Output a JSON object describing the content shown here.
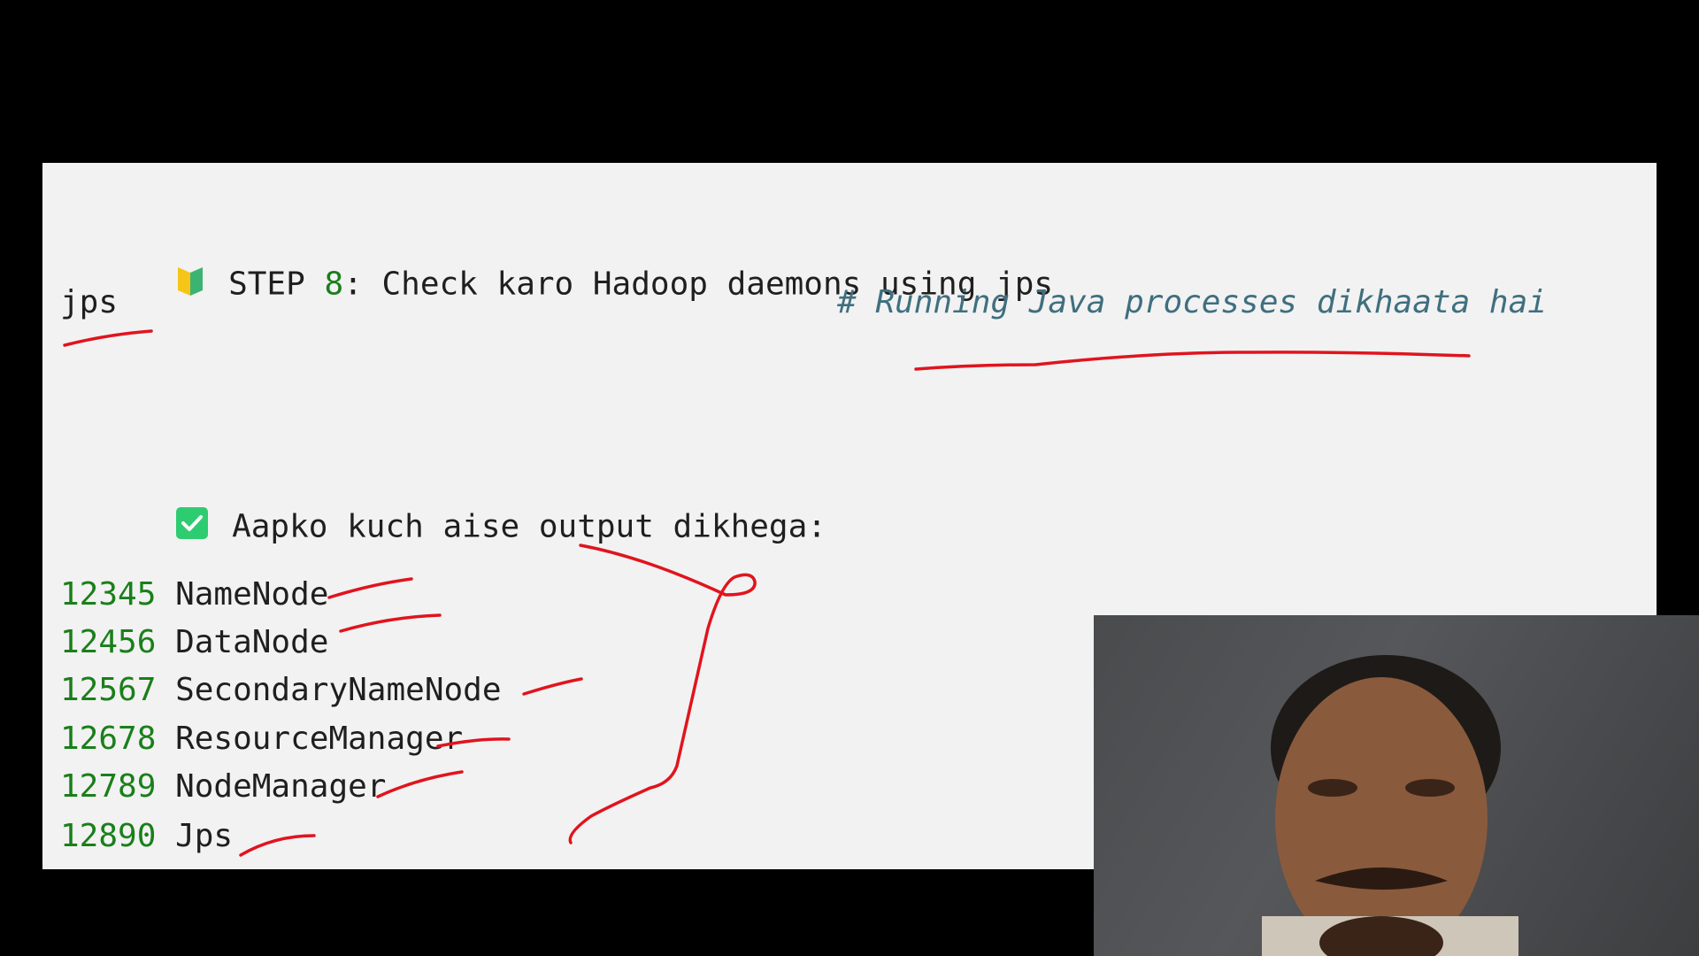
{
  "step": {
    "prefix": "STEP ",
    "number": "8",
    "text": ": Check karo Hadoop daemons using jps",
    "icon": "beginner-badge-icon"
  },
  "command": {
    "code": "jps",
    "comment": "# Running Java processes dikhaata hai"
  },
  "output_intro": {
    "icon": "check-mark-icon",
    "text": "Aapko kuch aise output dikhega:"
  },
  "processes": [
    {
      "pid": "12345",
      "name": "NameNode"
    },
    {
      "pid": "12456",
      "name": "DataNode"
    },
    {
      "pid": "12567",
      "name": "SecondaryNameNode"
    },
    {
      "pid": "12678",
      "name": "ResourceManager"
    },
    {
      "pid": "12789",
      "name": "NodeManager"
    },
    {
      "pid": "12890",
      "name": "Jps"
    }
  ],
  "colors": {
    "background": "#000000",
    "panel": "#f2f2f2",
    "pid_green": "#1a7f1a",
    "comment_teal": "#3f6f7f",
    "annotation_red": "#e0141e",
    "check_green": "#2ecc71"
  }
}
